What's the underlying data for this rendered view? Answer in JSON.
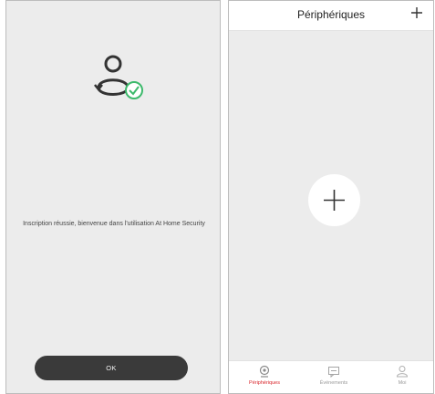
{
  "registration": {
    "message": "Inscription réussie, bienvenue dans l'utilisation At Home Security",
    "ok_label": "OK",
    "icon": "user-sync-check-icon"
  },
  "devices_screen": {
    "title": "Périphériques",
    "header_add_icon": "plus-icon",
    "center_add_icon": "plus-icon"
  },
  "tabbar": {
    "tabs": [
      {
        "label": "Périphériques",
        "icon": "camera-icon",
        "active": true
      },
      {
        "label": "Événements",
        "icon": "message-icon",
        "active": false
      },
      {
        "label": "Moi",
        "icon": "person-icon",
        "active": false
      }
    ]
  },
  "colors": {
    "accent": "#d9262c",
    "check": "#3cb96b",
    "button": "#3a3a3a",
    "background": "#ececec"
  }
}
